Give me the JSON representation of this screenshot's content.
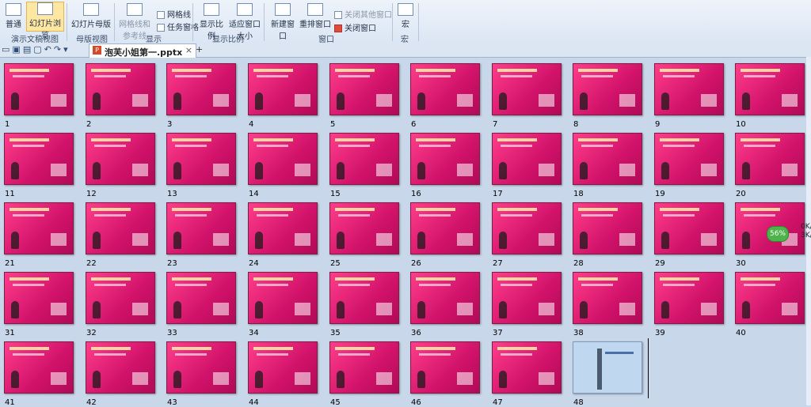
{
  "ribbon": {
    "groups": [
      {
        "label": "演示文稿视图",
        "items": [
          "普通",
          "幻灯片浏览"
        ]
      },
      {
        "label": "母版视图",
        "items": [
          "幻灯片母版"
        ]
      },
      {
        "label": "显示",
        "items": [
          "网格线",
          "任务窗格",
          "网格线和参考线"
        ]
      },
      {
        "label": "显示比例",
        "items": [
          "显示比例",
          "适应窗口大小"
        ]
      },
      {
        "label": "窗口",
        "items": [
          "新建窗口",
          "重排窗口",
          "关闭其他窗口",
          "关闭窗口"
        ]
      },
      {
        "label": "宏",
        "items": [
          "宏"
        ]
      }
    ]
  },
  "tabs": {
    "doc_name": "泡芙小姐第一.pptx",
    "close_symbol": "×",
    "new_symbol": "+"
  },
  "slides": {
    "numbers": [
      "1",
      "2",
      "3",
      "4",
      "5",
      "6",
      "7",
      "8",
      "9",
      "10",
      "11",
      "12",
      "13",
      "14",
      "15",
      "16",
      "17",
      "18",
      "19",
      "20",
      "21",
      "22",
      "23",
      "24",
      "25",
      "26",
      "27",
      "28",
      "29",
      "30",
      "31",
      "32",
      "33",
      "34",
      "35",
      "36",
      "37",
      "38",
      "39",
      "40",
      "41",
      "42",
      "43",
      "44",
      "45",
      "46",
      "47",
      "48"
    ]
  },
  "overlay": {
    "percent": "56%",
    "speed_up": "0K/",
    "speed_down": "3K/"
  }
}
